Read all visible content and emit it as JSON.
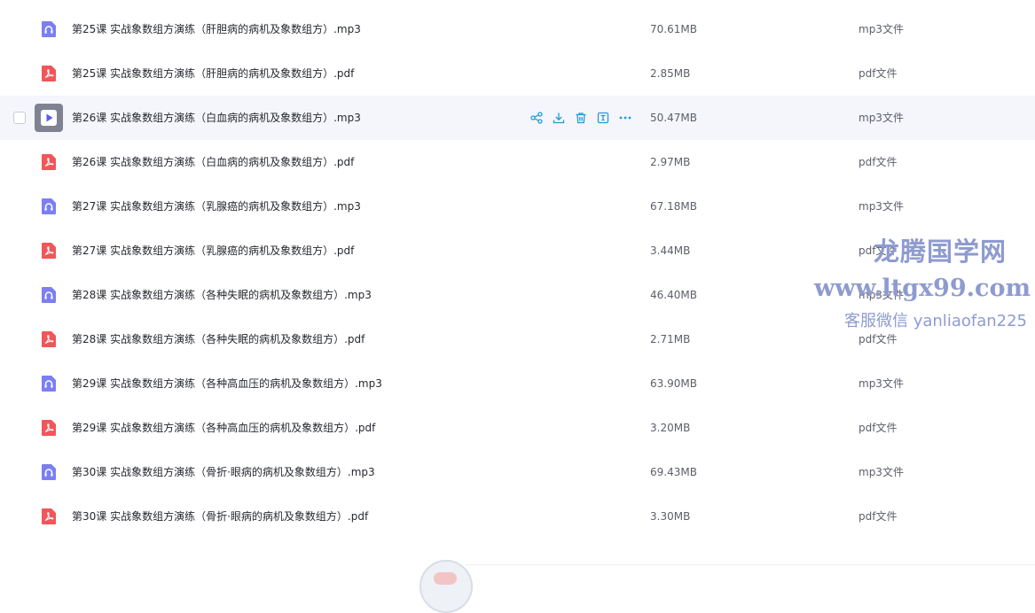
{
  "files": [
    {
      "name": "第25课 实战象数组方演练（肝胆病的病机及象数组方）.mp3",
      "size": "70.61MB",
      "type": "mp3文件",
      "icon": "audio-file-icon"
    },
    {
      "name": "第25课 实战象数组方演练（肝胆病的病机及象数组方）.pdf",
      "size": "2.85MB",
      "type": "pdf文件",
      "icon": "pdf-file-icon"
    },
    {
      "name": "第26课 实战象数组方演练（白血病的病机及象数组方）.mp3",
      "size": "50.47MB",
      "type": "mp3文件",
      "icon": "play-icon"
    },
    {
      "name": "第26课 实战象数组方演练（白血病的病机及象数组方）.pdf",
      "size": "2.97MB",
      "type": "pdf文件",
      "icon": "pdf-file-icon"
    },
    {
      "name": "第27课 实战象数组方演练（乳腺癌的病机及象数组方）.mp3",
      "size": "67.18MB",
      "type": "mp3文件",
      "icon": "audio-file-icon"
    },
    {
      "name": "第27课 实战象数组方演练（乳腺癌的病机及象数组方）.pdf",
      "size": "3.44MB",
      "type": "pdf文件",
      "icon": "pdf-file-icon"
    },
    {
      "name": "第28课 实战象数组方演练（各种失眠的病机及象数组方）.mp3",
      "size": "46.40MB",
      "type": "mp3文件",
      "icon": "audio-file-icon"
    },
    {
      "name": "第28课 实战象数组方演练（各种失眠的病机及象数组方）.pdf",
      "size": "2.71MB",
      "type": "pdf文件",
      "icon": "pdf-file-icon"
    },
    {
      "name": "第29课 实战象数组方演练（各种高血压的病机及象数组方）.mp3",
      "size": "63.90MB",
      "type": "mp3文件",
      "icon": "audio-file-icon"
    },
    {
      "name": "第29课 实战象数组方演练（各种高血压的病机及象数组方）.pdf",
      "size": "3.20MB",
      "type": "pdf文件",
      "icon": "pdf-file-icon"
    },
    {
      "name": "第30课 实战象数组方演练（骨折·眼病的病机及象数组方）.mp3",
      "size": "69.43MB",
      "type": "mp3文件",
      "icon": "audio-file-icon"
    },
    {
      "name": "第30课 实战象数组方演练（骨折·眼病的病机及象数组方）.pdf",
      "size": "3.30MB",
      "type": "pdf文件",
      "icon": "pdf-file-icon"
    }
  ],
  "hovered_row": 2,
  "row_actions": [
    "share-icon",
    "download-icon",
    "delete-icon",
    "rename-icon",
    "more-icon"
  ],
  "watermark": {
    "line1": "龙腾国学网",
    "line2": "www.ltgx99.com",
    "line3": "客服微信 yanliaofan225"
  },
  "colors": {
    "audio_icon": "#7b7ff2",
    "pdf_icon": "#f0565a",
    "action_icon": "#1f9bd8",
    "hover_bg": "#f4f6fb",
    "watermark": "#8e9bd0"
  }
}
